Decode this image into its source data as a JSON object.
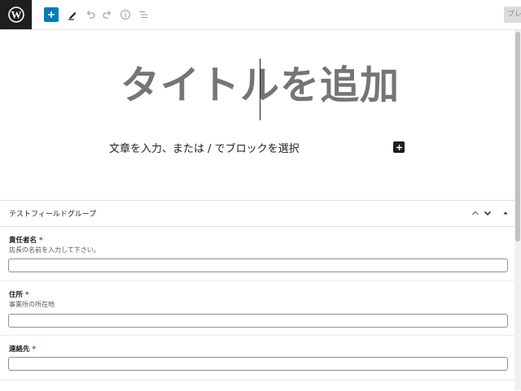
{
  "toolbar": {
    "add_block_icon": "plus-icon",
    "tools_icon": "pencil-icon",
    "undo_icon": "undo-icon",
    "redo_icon": "redo-icon",
    "details_icon": "info-icon",
    "list_view_icon": "list-view-icon",
    "preview_label": "プレビュー",
    "accent_color": "#007cba"
  },
  "editor": {
    "title_placeholder": "タイトルを追加",
    "paragraph_placeholder": "文章を入力、または / でブロックを選択"
  },
  "meta_box": {
    "title": "テストフィールドグループ",
    "fields": [
      {
        "label": "責任者名",
        "required_mark": "*",
        "description": "店長の名前を入力して下さい。"
      },
      {
        "label": "住所",
        "required_mark": "*",
        "description": "事業所の所在地"
      },
      {
        "label": "連絡先",
        "required_mark": "*",
        "description": ""
      }
    ]
  }
}
